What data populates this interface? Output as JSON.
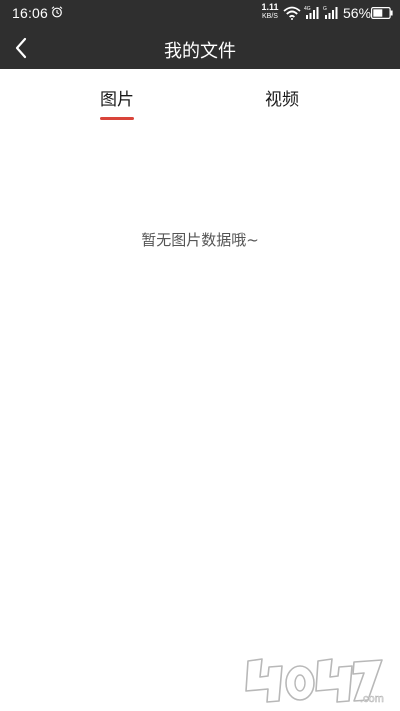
{
  "status_bar": {
    "time": "16:06",
    "net_speed_value": "1.11",
    "net_speed_unit": "KB/S",
    "battery_percent": "56%",
    "icons": [
      "alarm-icon",
      "wifi-icon",
      "signal-4g-icon",
      "signal-icon",
      "battery-icon"
    ]
  },
  "header": {
    "title": "我的文件",
    "back_icon": "chevron-left-icon",
    "background_color": "#2f2f2f"
  },
  "tabs": [
    {
      "label": "图片",
      "selected": true
    },
    {
      "label": "视频",
      "selected": false
    }
  ],
  "accent_color": "#d9443a",
  "empty_state": {
    "message": "暂无图片数据哦~"
  },
  "watermark": {
    "text": "4O4O7.com"
  }
}
